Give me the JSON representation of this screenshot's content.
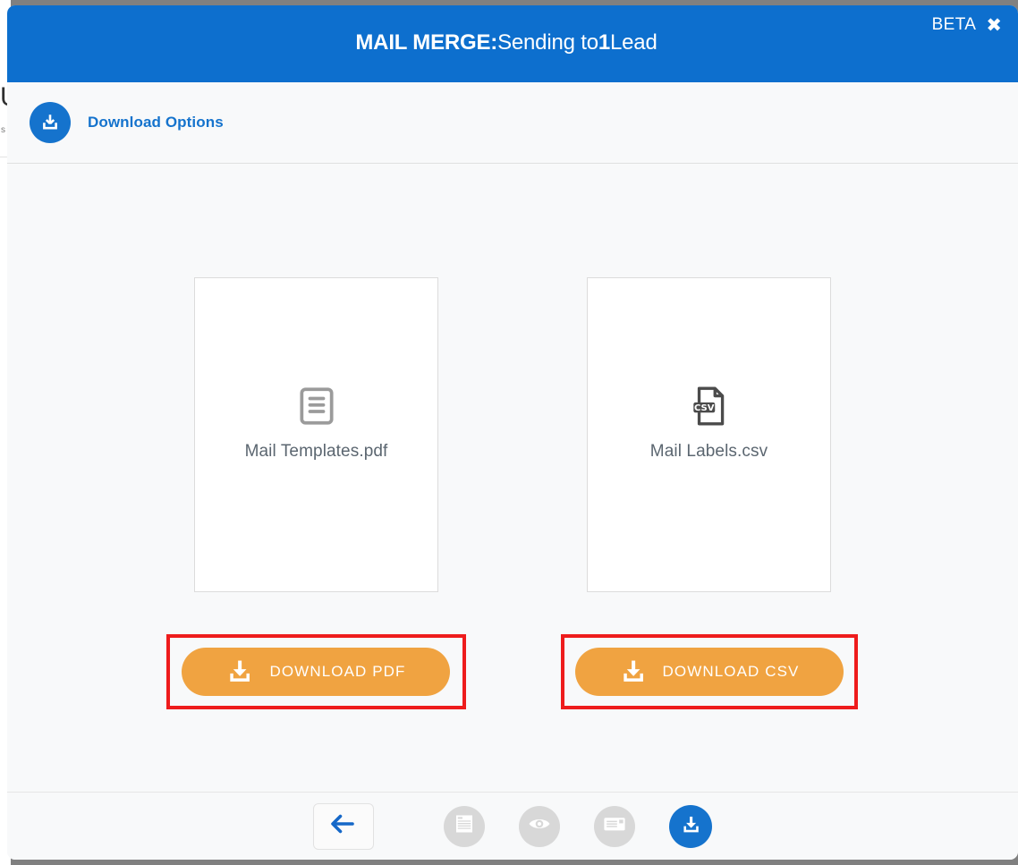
{
  "background_page": {
    "partial_glyph_large": "U",
    "partial_glyph_small": "s"
  },
  "modal": {
    "header": {
      "title_bold": "MAIL MERGE:",
      "title_rest_1": "Sending to",
      "title_count": "1",
      "title_rest_2": "Lead",
      "beta_badge": "BETA",
      "close_label": "✖",
      "background_color": "#0d6fce"
    },
    "section": {
      "icon": "download-circle-icon",
      "title": "Download Options",
      "accent_color": "#1573cd"
    },
    "cards": [
      {
        "id": "pdf",
        "icon": "document-lines-icon",
        "file_name": "Mail Templates.pdf",
        "button_label": "DOWNLOAD PDF",
        "button_icon": "download-icon",
        "button_color": "#f0a341",
        "highlight_color": "#ee1c1c"
      },
      {
        "id": "csv",
        "icon": "csv-file-icon",
        "icon_text": "CSV",
        "file_name": "Mail Labels.csv",
        "button_label": "DOWNLOAD CSV",
        "button_icon": "download-icon",
        "button_color": "#f0a341",
        "highlight_color": "#ee1c1c"
      }
    ],
    "footer": {
      "items": [
        {
          "name": "back-button",
          "icon": "arrow-left-icon",
          "state": "enabled"
        },
        {
          "name": "template-step",
          "icon": "document-icon",
          "state": "inactive"
        },
        {
          "name": "preview-step",
          "icon": "eye-icon",
          "state": "inactive"
        },
        {
          "name": "envelope-step",
          "icon": "envelope-icon",
          "state": "inactive"
        },
        {
          "name": "download-step",
          "icon": "download-icon",
          "state": "active"
        }
      ]
    }
  }
}
